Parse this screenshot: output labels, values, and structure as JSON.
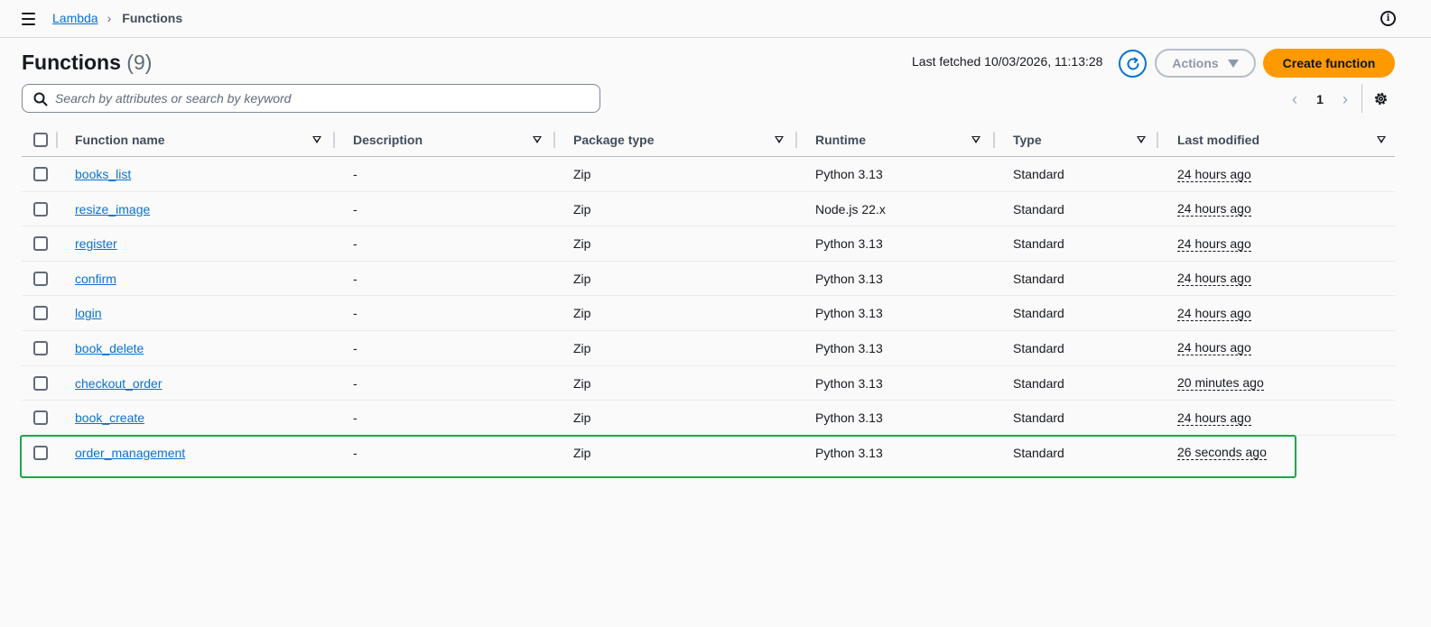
{
  "breadcrumb": {
    "service": "Lambda",
    "separator": "›",
    "current": "Functions"
  },
  "header": {
    "title": "Functions",
    "count": "(9)",
    "last_fetched": "Last fetched 10/03/2026, 11:13:28",
    "actions_label": "Actions",
    "create_label": "Create function"
  },
  "search": {
    "placeholder": "Search by attributes or search by keyword",
    "value": ""
  },
  "pagination": {
    "prev": "‹",
    "page": "1",
    "next": "›"
  },
  "table": {
    "columns": [
      "Function name",
      "Description",
      "Package type",
      "Runtime",
      "Type",
      "Last modified"
    ],
    "rows": [
      {
        "name": "books_list",
        "description": "-",
        "package": "Zip",
        "runtime": "Python 3.13",
        "type": "Standard",
        "modified": "24 hours ago"
      },
      {
        "name": "resize_image",
        "description": "-",
        "package": "Zip",
        "runtime": "Node.js 22.x",
        "type": "Standard",
        "modified": "24 hours ago"
      },
      {
        "name": "register",
        "description": "-",
        "package": "Zip",
        "runtime": "Python 3.13",
        "type": "Standard",
        "modified": "24 hours ago"
      },
      {
        "name": "confirm",
        "description": "-",
        "package": "Zip",
        "runtime": "Python 3.13",
        "type": "Standard",
        "modified": "24 hours ago"
      },
      {
        "name": "login",
        "description": "-",
        "package": "Zip",
        "runtime": "Python 3.13",
        "type": "Standard",
        "modified": "24 hours ago"
      },
      {
        "name": "book_delete",
        "description": "-",
        "package": "Zip",
        "runtime": "Python 3.13",
        "type": "Standard",
        "modified": "24 hours ago"
      },
      {
        "name": "checkout_order",
        "description": "-",
        "package": "Zip",
        "runtime": "Python 3.13",
        "type": "Standard",
        "modified": "20 minutes ago"
      },
      {
        "name": "book_create",
        "description": "-",
        "package": "Zip",
        "runtime": "Python 3.13",
        "type": "Standard",
        "modified": "24 hours ago"
      },
      {
        "name": "order_management",
        "description": "-",
        "package": "Zip",
        "runtime": "Python 3.13",
        "type": "Standard",
        "modified": "26 seconds ago"
      }
    ]
  },
  "colors": {
    "accent": "#0972d3",
    "primary_button": "#ff9900",
    "highlight": "#1ea64b"
  },
  "icons": [
    "menu-icon",
    "chevron-right-icon",
    "info-icon",
    "refresh-icon",
    "caret-down-icon",
    "search-icon",
    "settings-icon",
    "sort-icon"
  ]
}
